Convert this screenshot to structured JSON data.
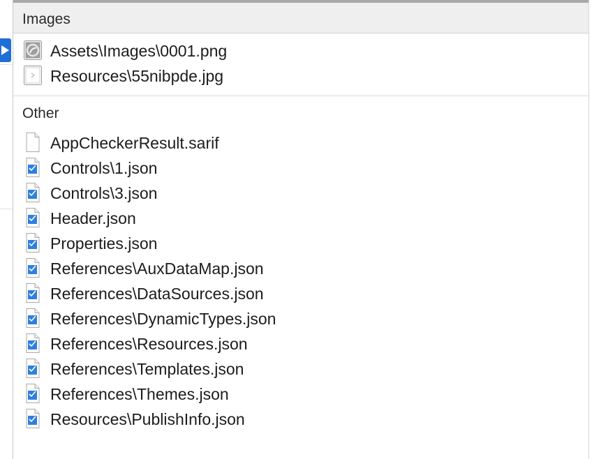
{
  "images_section": {
    "title": "Images",
    "files": [
      {
        "name": "Assets\\Images\\0001.png",
        "icon": "png-image-icon"
      },
      {
        "name": "Resources\\55nibpde.jpg",
        "icon": "jpg-image-icon"
      }
    ]
  },
  "other_section": {
    "title": "Other",
    "files": [
      {
        "name": "AppCheckerResult.sarif",
        "icon": "blank-document-icon"
      },
      {
        "name": "Controls\\1.json",
        "icon": "json-file-icon"
      },
      {
        "name": "Controls\\3.json",
        "icon": "json-file-icon"
      },
      {
        "name": "Header.json",
        "icon": "json-file-icon"
      },
      {
        "name": "Properties.json",
        "icon": "json-file-icon"
      },
      {
        "name": "References\\AuxDataMap.json",
        "icon": "json-file-icon"
      },
      {
        "name": "References\\DataSources.json",
        "icon": "json-file-icon"
      },
      {
        "name": "References\\DynamicTypes.json",
        "icon": "json-file-icon"
      },
      {
        "name": "References\\Resources.json",
        "icon": "json-file-icon"
      },
      {
        "name": "References\\Templates.json",
        "icon": "json-file-icon"
      },
      {
        "name": "References\\Themes.json",
        "icon": "json-file-icon"
      },
      {
        "name": "Resources\\PublishInfo.json",
        "icon": "json-file-icon"
      }
    ]
  },
  "colors": {
    "selection": "#1f6fd6",
    "json_icon_blue": "#2f7fe0",
    "header_bg": "#efefef"
  }
}
